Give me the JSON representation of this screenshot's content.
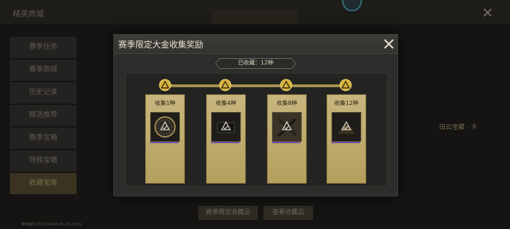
{
  "background": {
    "logo_text": "精英商城",
    "sidebar": [
      "赛季任务",
      "赛季商城",
      "历史记录",
      "精选推荐",
      "赛季宝箱",
      "特殊宝箱",
      "收藏宝库"
    ],
    "footer_text": "赛季编号2892214490-06-08-22:04",
    "buttons": [
      "赛季限定收藏品",
      "查看收藏品"
    ],
    "right_label": "田云宝藏 · 卡"
  },
  "modal": {
    "title": "赛季限定大金收集奖励",
    "collected_label": "已收藏：12种",
    "rewards": [
      {
        "label": "收集1种",
        "item_icon": "round-emblem-icon"
      },
      {
        "label": "收集4种",
        "item_icon": "dark-case-icon"
      },
      {
        "label": "收集8种",
        "item_icon": "crossed-weapons-icon"
      },
      {
        "label": "收集12种",
        "item_icon": "bronze-armor-icon"
      }
    ]
  },
  "colors": {
    "accent_gold": "#c8b67f",
    "track_gold": "#a8904f",
    "node_gold": "#d6b23c",
    "modal_bg": "#2d2d2b"
  }
}
